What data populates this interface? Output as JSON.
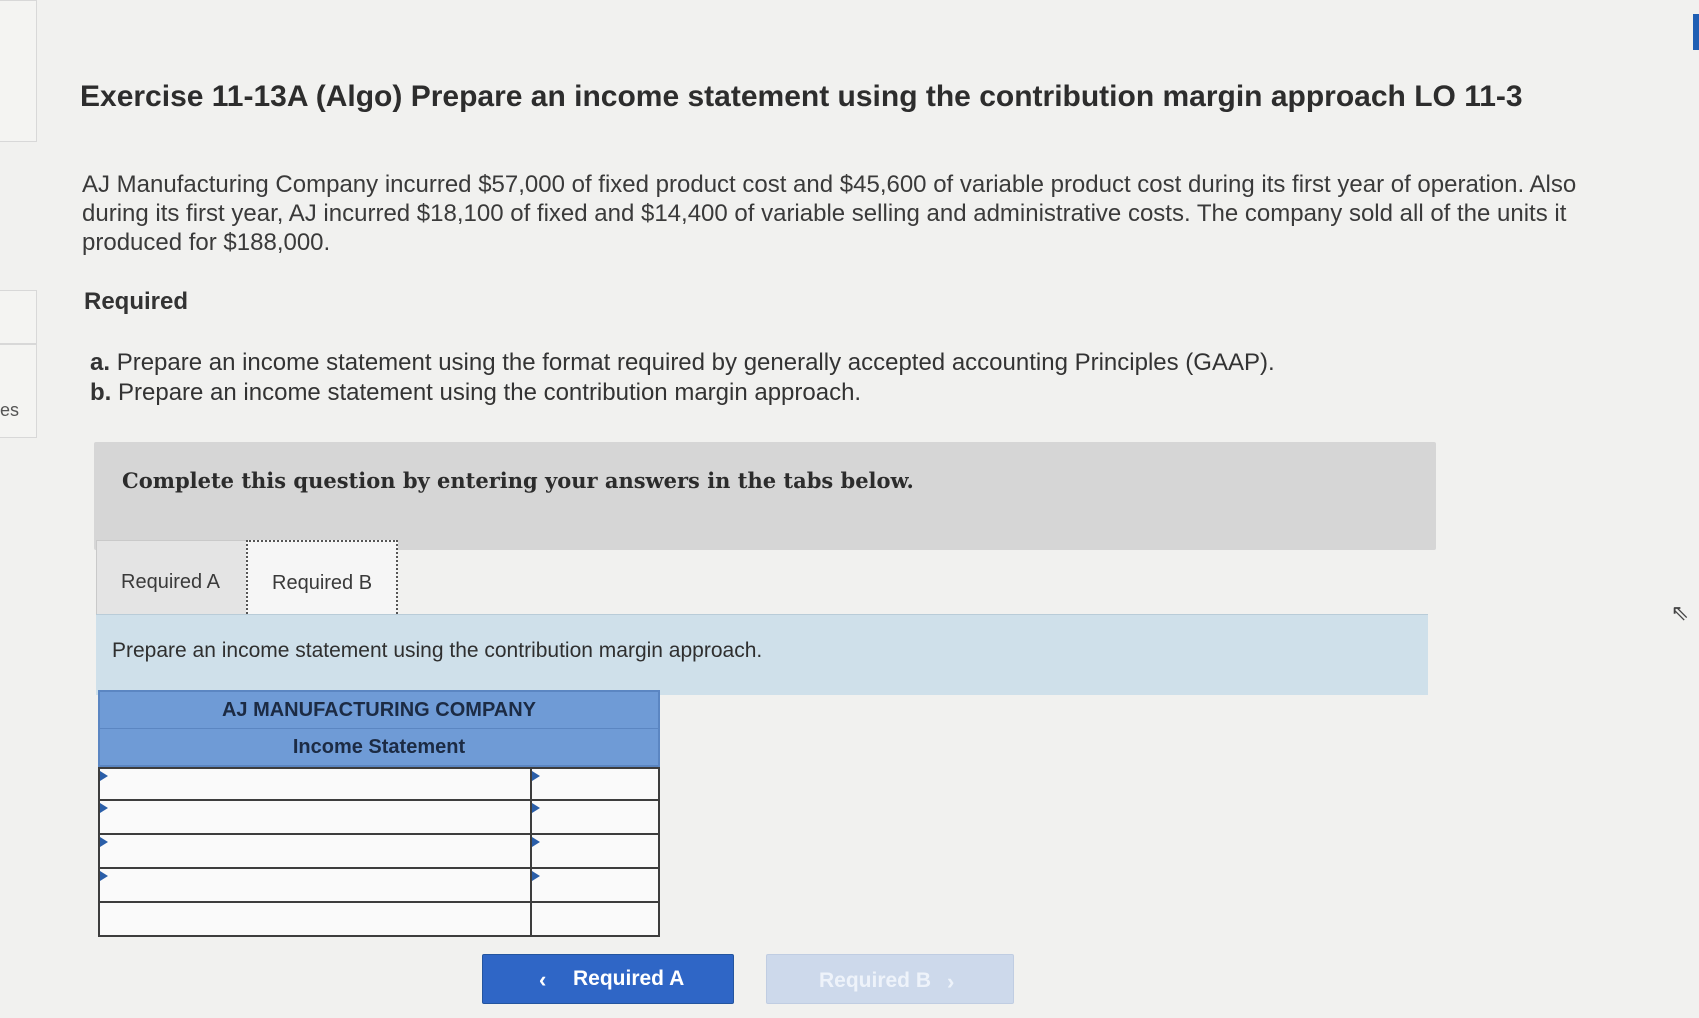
{
  "exercise": {
    "title": "Exercise 11-13A (Algo) Prepare an income statement using the contribution margin approach LO 11-3",
    "intro": "AJ Manufacturing Company incurred $57,000 of fixed product cost and $45,600 of variable product cost during its first year of operation. Also during its first year, AJ incurred $18,100 of fixed and $14,400 of variable selling and administrative costs. The company sold all of the units it produced for $188,000.",
    "required_heading": "Required",
    "requirements": [
      {
        "letter": "a.",
        "text": "Prepare an income statement using the format required by generally accepted accounting Principles (GAAP)."
      },
      {
        "letter": "b.",
        "text": "Prepare an income statement using the contribution margin approach."
      }
    ]
  },
  "left_rail": {
    "partial_text": "es"
  },
  "instruction": "Complete this question by entering your answers in the tabs below.",
  "tabs": [
    {
      "label": "Required A"
    },
    {
      "label": "Required B"
    }
  ],
  "active_prompt": "Prepare an income statement using the contribution margin approach.",
  "statement": {
    "company": "AJ MANUFACTURING COMPANY",
    "subtitle": "Income Statement",
    "rows": [
      {
        "label": "",
        "amount": ""
      },
      {
        "label": "",
        "amount": ""
      },
      {
        "label": "",
        "amount": ""
      },
      {
        "label": "",
        "amount": ""
      },
      {
        "label": "",
        "amount": ""
      }
    ]
  },
  "nav": {
    "prev_label": "Required A",
    "next_label": "Required B",
    "prev_icon": "chevron-left-icon",
    "next_icon": "chevron-right-icon"
  },
  "colors": {
    "primary_button": "#2f66c6",
    "disabled_button": "#cdd9eb",
    "table_header": "#6f9bd6",
    "prompt_bar": "#cfe0ea"
  }
}
